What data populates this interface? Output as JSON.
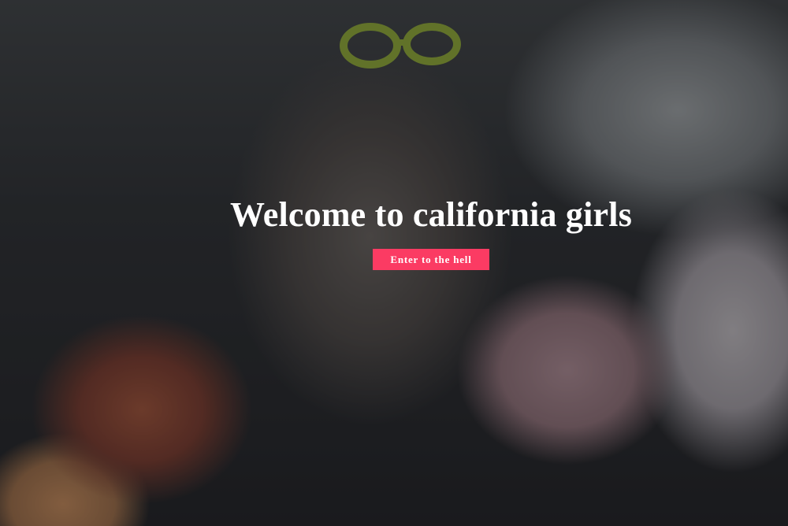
{
  "hero": {
    "title": "Welcome to california girls",
    "button_label": "Enter to the hell",
    "button_color": "#fb3b63",
    "title_color": "#ffffff",
    "overlay_color": "rgba(0,0,0,0.42)"
  }
}
